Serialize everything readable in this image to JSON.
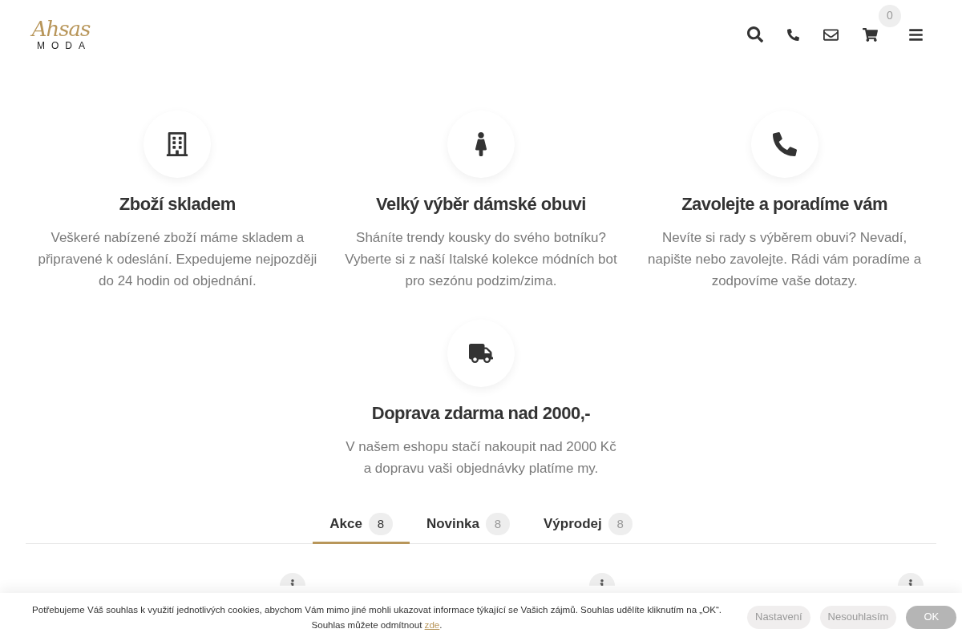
{
  "logo": {
    "script": "Ahsas",
    "word": "MODA"
  },
  "header": {
    "cart_count": "0"
  },
  "features": [
    {
      "title": "Zboží skladem",
      "text": "Veškeré nabízené zboží máme skladem a připravené k odeslání. Expedujeme nejpozději do 24 hodin od objednání."
    },
    {
      "title": "Velký výběr dámské obuvi",
      "text": "Sháníte trendy kousky do svého botníku? Vyberte si z naší Italské kolekce módních bot pro sezónu podzim/zima."
    },
    {
      "title": "Zavolejte a poradíme vám",
      "text": "Nevíte si rady s výběrem obuvi? Nevadí, napište nebo zavolejte. Rádi vám poradíme a zodpovíme vaše dotazy."
    },
    {
      "title": "Doprava zdarma nad 2000,-",
      "text": "V našem eshopu stačí nakoupit nad 2000 Kč a dopravu vaši objednávky platíme my."
    }
  ],
  "tabs": [
    {
      "label": "Akce",
      "count": "8",
      "selected": true
    },
    {
      "label": "Novinka",
      "count": "8",
      "selected": false
    },
    {
      "label": "Výprodej",
      "count": "8",
      "selected": false
    }
  ],
  "cookie_bar": {
    "text": "Potřebujeme Váš souhlas k využití jednotlivých cookies, abychom Vám mimo jiné mohli ukazovat informace týkající se Vašich zájmů. Souhlas udělíte kliknutím na „OK“.",
    "text2": "Souhlas můžete odmítnout",
    "link": "zde",
    "after_link": ".",
    "buttons": [
      "Nastavení",
      "Nesouhlasím",
      "OK"
    ]
  }
}
